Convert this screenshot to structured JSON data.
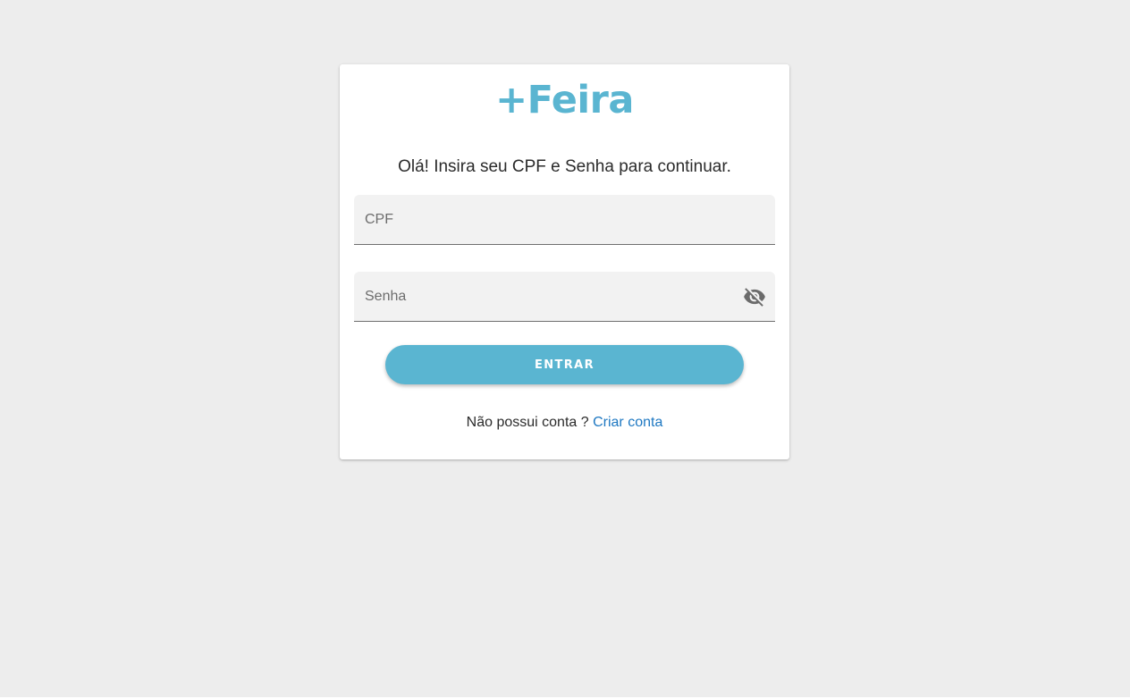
{
  "brand": {
    "logo_text": "+Feira",
    "color": "#5ab5d1"
  },
  "login": {
    "greeting": "Olá! Insira seu CPF e Senha para continuar.",
    "cpf_label": "CPF",
    "cpf_value": "",
    "password_label": "Senha",
    "password_value": "",
    "password_toggle_icon": "visibility-off-icon",
    "submit_label": "ENTRAR",
    "submit_color": "#5ab5d1",
    "no_account_text": "Não possui conta ?",
    "create_account_link": "Criar conta",
    "link_color": "#1e78c2"
  }
}
